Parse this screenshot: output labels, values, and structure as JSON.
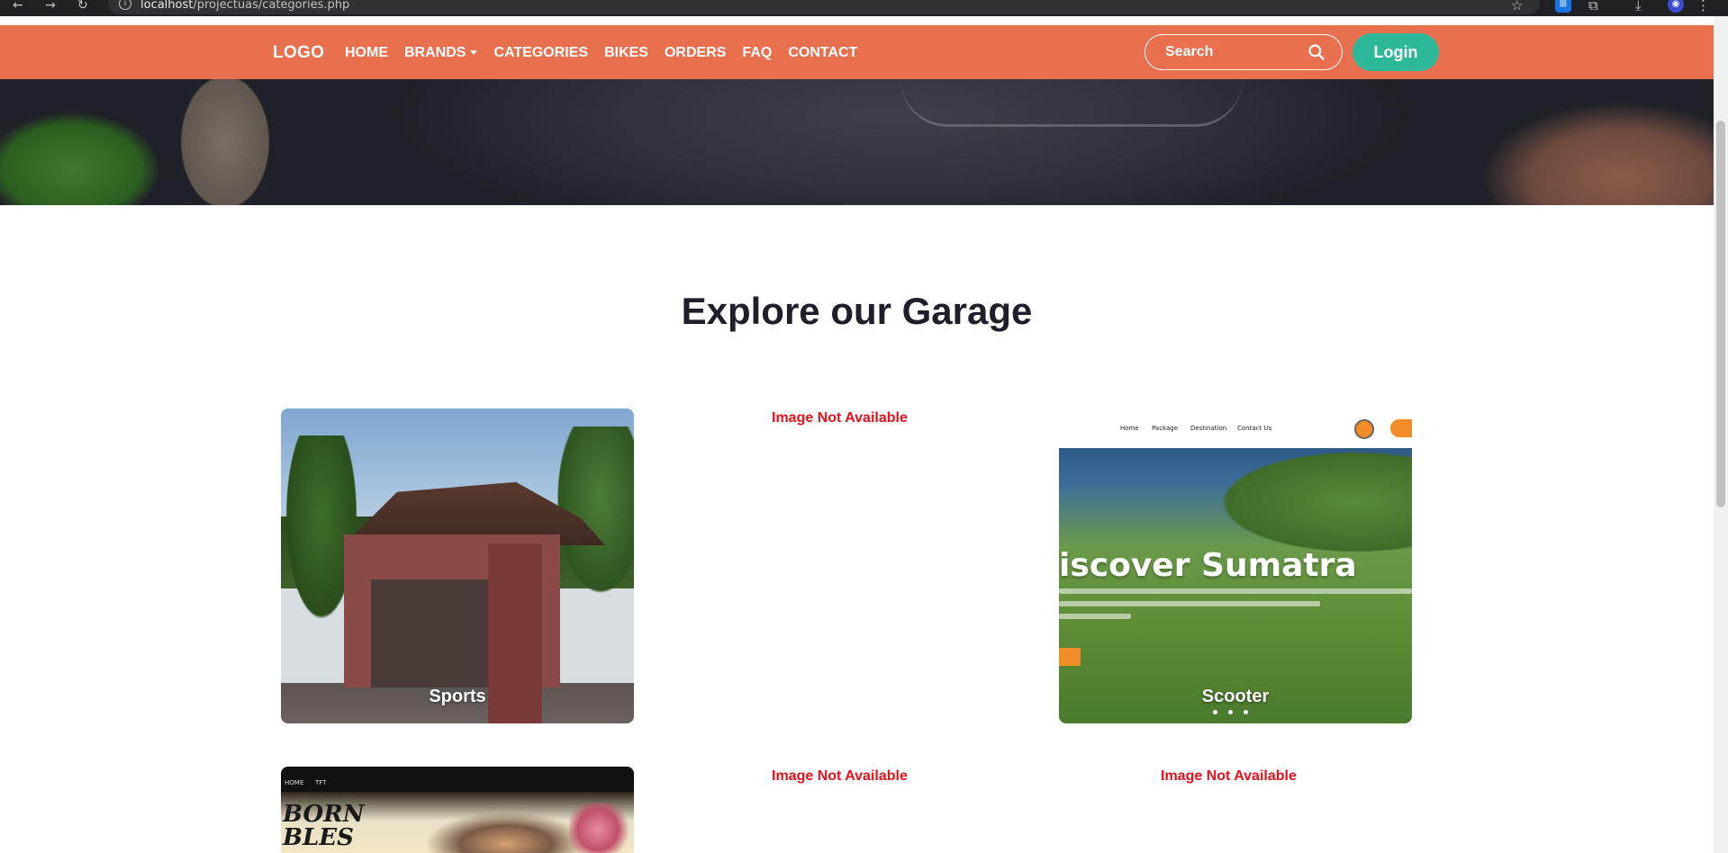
{
  "browser": {
    "url_host": "localhost",
    "url_path": "/projectuas/categories.php"
  },
  "navbar": {
    "logo": "LOGO",
    "links": [
      "HOME",
      "BRANDS",
      "CATEGORIES",
      "BIKES",
      "ORDERS",
      "FAQ",
      "CONTACT"
    ],
    "search_placeholder": "Search",
    "login_label": "Login"
  },
  "main": {
    "heading": "Explore our Garage",
    "cards": [
      {
        "label": "Sports",
        "image_available": true
      },
      {
        "label": "",
        "image_available": false,
        "fallback_text": "Image Not Available"
      },
      {
        "label": "Scooter",
        "image_available": true
      },
      {
        "label": "",
        "image_available": true
      },
      {
        "label": "",
        "image_available": false,
        "fallback_text": "Image Not Available"
      },
      {
        "label": "",
        "image_available": false,
        "fallback_text": "Image Not Available"
      }
    ]
  },
  "thumbnail_text": {
    "scooter_site": {
      "nav": [
        "Home",
        "Package",
        "Destination",
        "Contact Us"
      ],
      "headline": "iscover Sumatra"
    },
    "game_site": {
      "nav": [
        "HOME",
        "TFT"
      ],
      "headline_line1": "BORN",
      "headline_line2": "BLES"
    }
  },
  "colors": {
    "navbar": "#e8704f",
    "login_button": "#2eb89a",
    "not_available_text": "#e8101a",
    "heading_text": "#1e1f2b"
  }
}
